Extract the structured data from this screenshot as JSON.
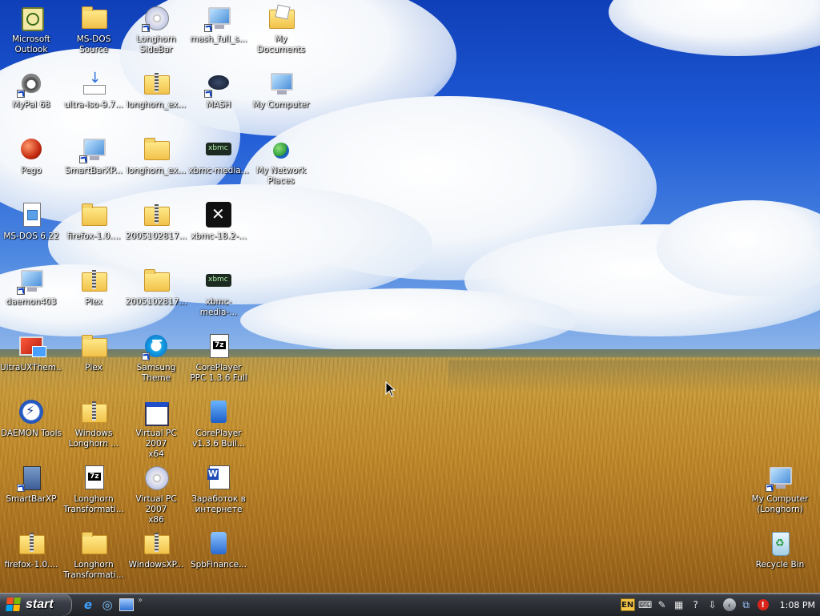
{
  "desktop": {
    "icons": [
      {
        "label": "Microsoft\nOutlook",
        "icon": "outlook-icon"
      },
      {
        "label": "MS-DOS\nSource",
        "icon": "folder-icon"
      },
      {
        "label": "Longhorn\nSideBar",
        "icon": "cd-icon"
      },
      {
        "label": "mash_full_s...",
        "icon": "monitor-icon"
      },
      {
        "label": "My Documents",
        "icon": "my-documents-icon"
      },
      {
        "label": "MyPal 68",
        "icon": "raccoon-icon"
      },
      {
        "label": "ultra-iso-9.7...",
        "icon": "download-icon"
      },
      {
        "label": "longhorn_ex...",
        "icon": "zip-folder-icon"
      },
      {
        "label": "MASH",
        "icon": "mash-icon"
      },
      {
        "label": "My Computer",
        "icon": "my-computer-icon"
      },
      {
        "label": "Pego",
        "icon": "red-sphere-icon"
      },
      {
        "label": "SmartBarXP...",
        "icon": "installer-icon"
      },
      {
        "label": "longhorn_ex...",
        "icon": "folder-icon"
      },
      {
        "label": "xbmc-media...",
        "icon": "xbmc-icon"
      },
      {
        "label": "My Network\nPlaces",
        "icon": "network-places-icon"
      },
      {
        "label": "MS-DOS 6.22",
        "icon": "document-icon"
      },
      {
        "label": "firefox-1.0....",
        "icon": "folder-icon"
      },
      {
        "label": "2005102817...",
        "icon": "zip-folder-icon"
      },
      {
        "label": "xbmc-18.2-...",
        "icon": "xbmc-logo-icon"
      },
      {
        "label": "daemon403",
        "icon": "installer-icon"
      },
      {
        "label": "Plex",
        "icon": "zip-folder-icon"
      },
      {
        "label": "2005102817...",
        "icon": "folder-icon"
      },
      {
        "label": "xbmc-media-...",
        "icon": "xbmc-icon"
      },
      {
        "label": "UltraUXThem...",
        "icon": "ultraux-icon"
      },
      {
        "label": "Plex",
        "icon": "folder-icon"
      },
      {
        "label": "Samsung\nTheme",
        "icon": "samsung-theme-icon"
      },
      {
        "label": "CorePlayer\nPPC 1.3.6 Full",
        "icon": "7z-archive-icon"
      },
      {
        "label": "DAEMON Tools",
        "icon": "daemon-tools-icon"
      },
      {
        "label": "Windows\nLonghorn ...",
        "icon": "zip-folder-icon"
      },
      {
        "label": "Virtual PC 2007\nx64",
        "icon": "window-icon"
      },
      {
        "label": "CorePlayer\nv1.3.6 Buil...",
        "icon": "coreplayer-icon"
      },
      {
        "label": "SmartBarXP",
        "icon": "smartbar-icon"
      },
      {
        "label": "Longhorn\nTransformati...",
        "icon": "7z-archive-icon"
      },
      {
        "label": "Virtual PC 2007\nx86",
        "icon": "cd-icon"
      },
      {
        "label": "Заработок в\nинтернете",
        "icon": "word-document-icon"
      },
      {
        "label": "firefox-1.0....",
        "icon": "zip-folder-icon"
      },
      {
        "label": "Longhorn\nTransformati...",
        "icon": "folder-icon"
      },
      {
        "label": "WindowsXP...",
        "icon": "zip-folder-icon"
      },
      {
        "label": "SpbFinance...",
        "icon": "spb-finance-icon"
      },
      {
        "label": "My Computer\n(Longhorn)",
        "icon": "my-computer-icon"
      },
      {
        "label": "Recycle Bin",
        "icon": "recycle-bin-icon"
      }
    ]
  },
  "taskbar": {
    "start_label": "start",
    "quick_launch": [
      "internet-explorer-icon",
      "internet-explorer-alt-icon",
      "show-desktop-icon"
    ],
    "quick_launch_more": "»",
    "tray": {
      "language": "EN",
      "icons": [
        "keyboard-icon",
        "pen-icon",
        "network-icon",
        "help-icon",
        "usb-icon",
        "expand-tray-icon",
        "network-connections-icon",
        "security-alert-icon"
      ],
      "clock": "1:08 PM"
    }
  },
  "colors": {
    "taskbar": "#2c2f35",
    "start_flag": [
      "#f25022",
      "#7fba00",
      "#00a4ef",
      "#ffb900"
    ],
    "label_text": "#ffffff"
  }
}
